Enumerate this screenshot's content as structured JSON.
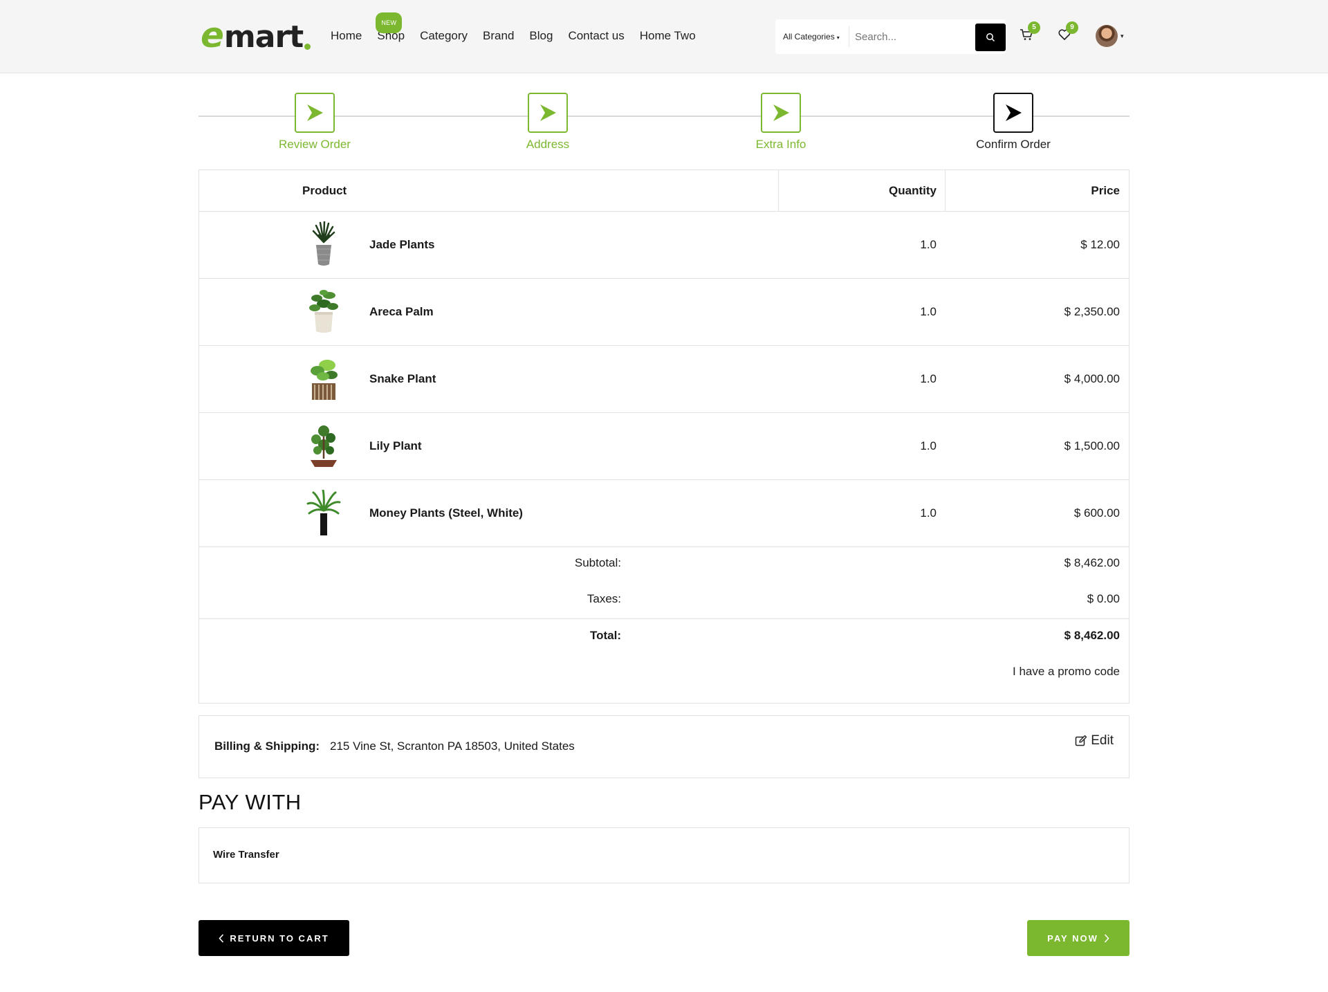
{
  "header": {
    "logo": {
      "e": "e",
      "rest": "mart"
    },
    "nav": [
      {
        "label": "Home"
      },
      {
        "label": "Shop",
        "badge": "NEW"
      },
      {
        "label": "Category"
      },
      {
        "label": "Brand"
      },
      {
        "label": "Blog"
      },
      {
        "label": "Contact us"
      },
      {
        "label": "Home Two"
      }
    ],
    "search": {
      "category": "All Categories",
      "placeholder": "Search..."
    },
    "cart_count": "5",
    "wishlist_count": "9",
    "icons": [
      "search-icon",
      "cart-icon",
      "heart-icon",
      "avatar"
    ]
  },
  "steps": [
    {
      "label": "Review Order",
      "state": "done"
    },
    {
      "label": "Address",
      "state": "done"
    },
    {
      "label": "Extra Info",
      "state": "done"
    },
    {
      "label": "Confirm Order",
      "state": "active"
    }
  ],
  "order": {
    "headers": {
      "product": "Product",
      "quantity": "Quantity",
      "price": "Price"
    },
    "items": [
      {
        "name": "Jade Plants",
        "qty": "1.0",
        "price": "$ 12.00"
      },
      {
        "name": "Areca Palm",
        "qty": "1.0",
        "price": "$ 2,350.00"
      },
      {
        "name": "Snake Plant",
        "qty": "1.0",
        "price": "$ 4,000.00"
      },
      {
        "name": "Lily Plant",
        "qty": "1.0",
        "price": "$ 1,500.00"
      },
      {
        "name": "Money Plants (Steel, White)",
        "qty": "1.0",
        "price": "$ 600.00"
      }
    ],
    "subtotal_label": "Subtotal:",
    "subtotal": "$ 8,462.00",
    "taxes_label": "Taxes:",
    "taxes": "$ 0.00",
    "total_label": "Total:",
    "total": "$ 8,462.00",
    "promo": "I have a promo code"
  },
  "billing": {
    "label": "Billing & Shipping:",
    "address": "215 Vine St, Scranton PA 18503, United States",
    "edit": "Edit"
  },
  "payment": {
    "title": "PAY WITH",
    "option": "Wire Transfer"
  },
  "buttons": {
    "return": "RETURN TO CART",
    "pay": "PAY NOW"
  },
  "colors": {
    "accent": "#7cb82f",
    "dark": "#000000",
    "border": "#e2e2e2"
  }
}
